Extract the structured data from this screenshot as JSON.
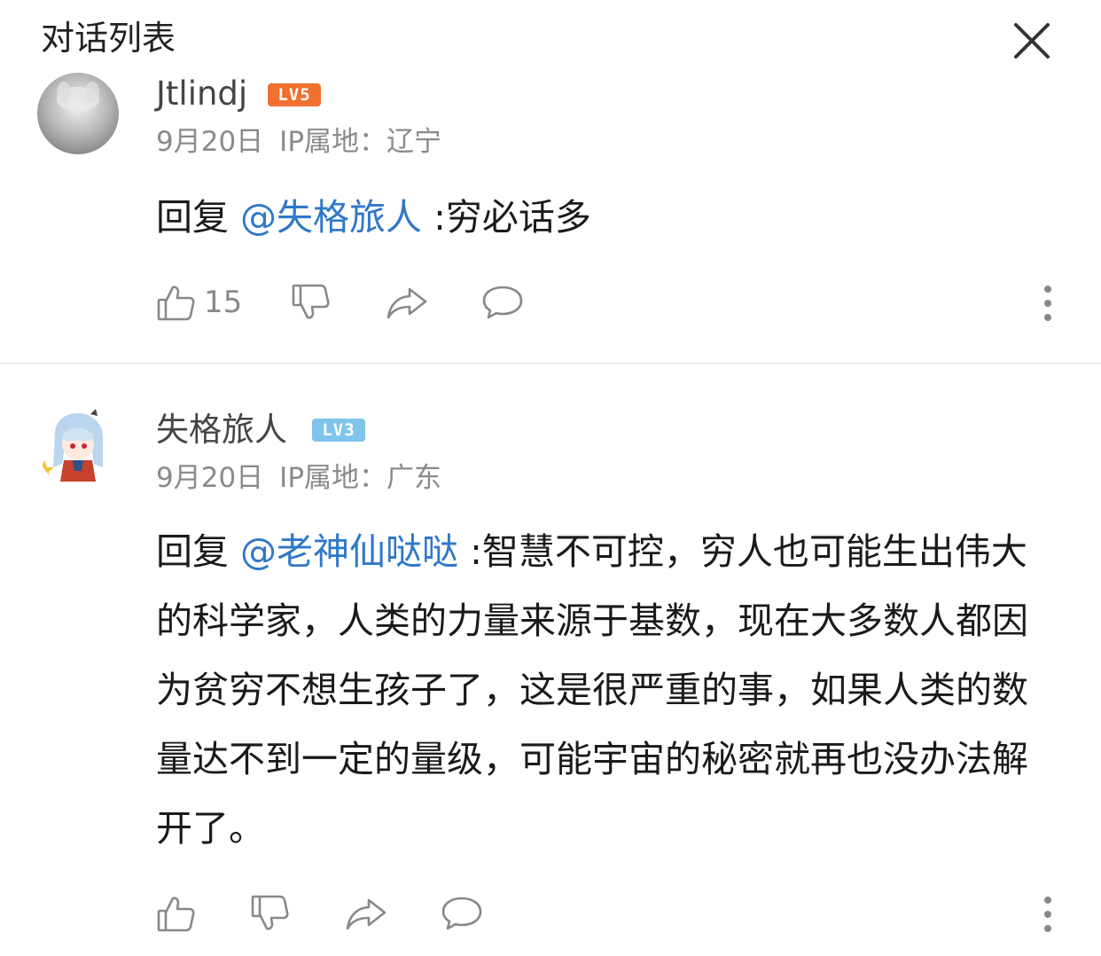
{
  "header": {
    "title": "对话列表",
    "close_icon": "close-icon"
  },
  "comments": [
    {
      "username": "Jtlindj",
      "level": "LV5",
      "level_color": "#f07030",
      "date": "9月20日",
      "location": "IP属地：辽宁",
      "reply_prefix": "回复 ",
      "mention": "@失格旅人",
      "text": " :穷必话多",
      "like_count": "15"
    },
    {
      "username": "失格旅人",
      "level": "LV3",
      "level_color": "#7fc4ea",
      "date": "9月20日",
      "location": "IP属地：广东",
      "reply_prefix": "回复 ",
      "mention": "@老神仙哒哒",
      "text": " :智慧不可控，穷人也可能生出伟大的科学家，人类的力量来源于基数，现在大多数人都因为贫穷不想生孩子了，这是很严重的事，如果人类的数量达不到一定的量级，可能宇宙的秘密就再也没办法解开了。",
      "like_count": ""
    }
  ],
  "icons": [
    "thumbs-up-icon",
    "thumbs-down-icon",
    "share-icon",
    "comment-icon",
    "more-icon"
  ],
  "colors": {
    "mention": "#2f78c9",
    "meta": "#8a8a8a",
    "icon": "#888888"
  }
}
